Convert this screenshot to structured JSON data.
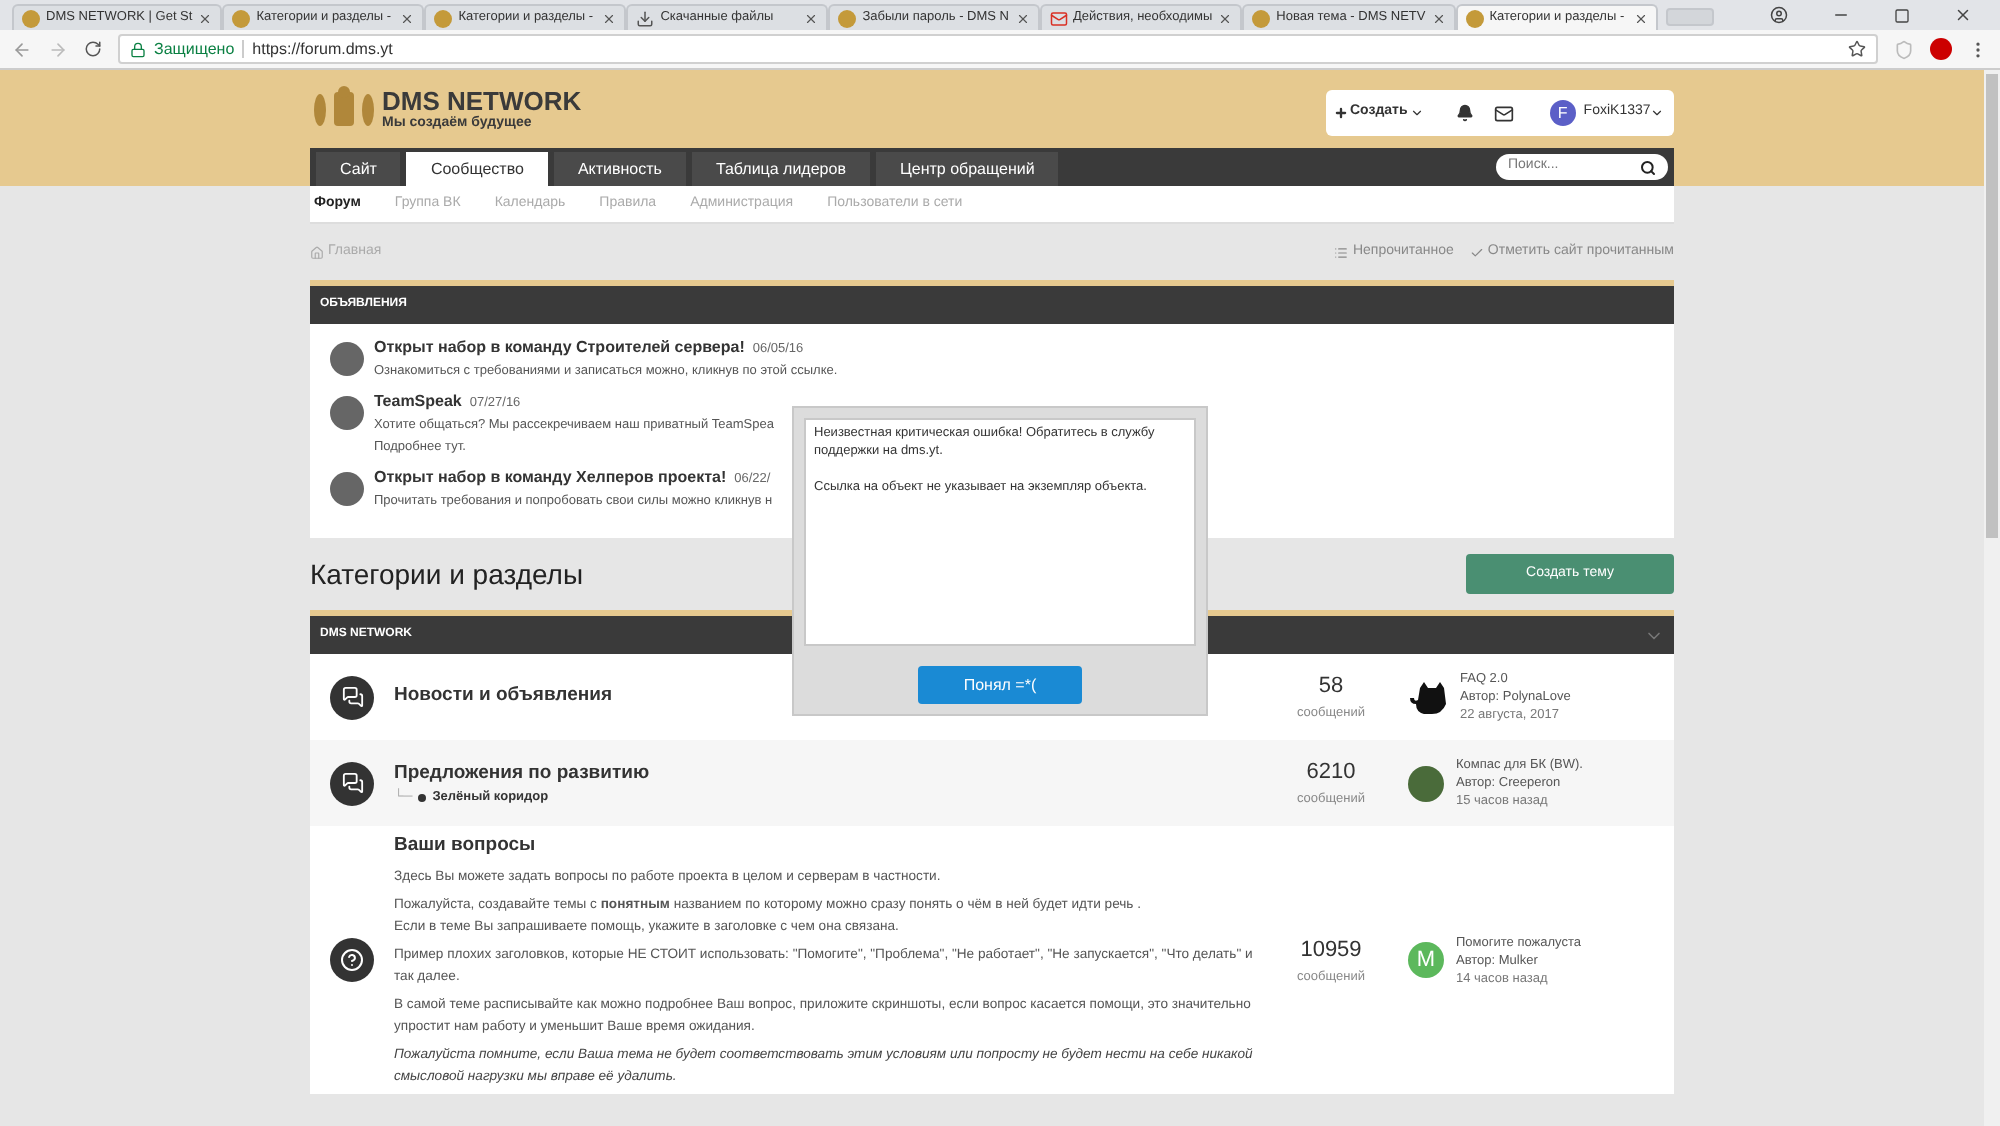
{
  "browser": {
    "tabs": [
      {
        "title": "DMS NETWORK | Get St",
        "kind": "site",
        "selected": false
      },
      {
        "title": "Категории и разделы -",
        "kind": "site",
        "selected": false
      },
      {
        "title": "Категории и разделы -",
        "kind": "site",
        "selected": false
      },
      {
        "title": "Скачанные файлы",
        "kind": "download",
        "selected": false
      },
      {
        "title": "Забыли пароль - DMS N",
        "kind": "site",
        "selected": false
      },
      {
        "title": "Действия, необходимы",
        "kind": "mail",
        "selected": false
      },
      {
        "title": "Новая тема - DMS NETV",
        "kind": "site",
        "selected": false
      },
      {
        "title": "Категории и разделы -",
        "kind": "site",
        "selected": true
      }
    ],
    "secure_label": "Защищено",
    "url": "https://forum.dms.yt"
  },
  "header": {
    "logo_title": "DMS NETWORK",
    "logo_subtitle": "Мы создаём будущее",
    "create_label": "Создать",
    "avatar_letter": "F",
    "username": "FoxiK1337"
  },
  "nav": {
    "tabs": [
      {
        "label": "Сайт",
        "selected": false
      },
      {
        "label": "Сообщество",
        "selected": true
      },
      {
        "label": "Активность",
        "selected": false
      },
      {
        "label": "Таблица лидеров",
        "selected": false
      },
      {
        "label": "Центр обращений",
        "selected": false
      }
    ],
    "search_placeholder": "Поиск..."
  },
  "subnav": [
    {
      "label": "Форум",
      "selected": true
    },
    {
      "label": "Группа ВК",
      "selected": false
    },
    {
      "label": "Календарь",
      "selected": false
    },
    {
      "label": "Правила",
      "selected": false
    },
    {
      "label": "Администрация",
      "selected": false
    },
    {
      "label": "Пользователи в сети",
      "selected": false
    }
  ],
  "breadcrumb": "Главная",
  "actions": [
    {
      "label": "Непрочитанное",
      "kind": "list"
    },
    {
      "label": "Отметить сайт прочитанным",
      "kind": "check"
    }
  ],
  "announcements": {
    "title": "ОБЪЯВЛЕНИЯ",
    "items": [
      {
        "title": "Открыт набор в команду Строителей сервера!",
        "date": "06/05/16",
        "lines": [
          "Ознакомиться с требованиями и записаться можно, кликнув по этой ссылке."
        ]
      },
      {
        "title": "TeamSpeak",
        "date": "07/27/16",
        "lines": [
          "Хотите общаться? Мы рассекречиваем наш приватный TeamSpea",
          "Подробнее тут."
        ]
      },
      {
        "title": "Открыт набор в команду Хелперов проекта!",
        "date": "06/22/",
        "lines": [
          "Прочитать требования и попробовать свои силы можно кликнув н"
        ]
      }
    ]
  },
  "categories_title": "Категории и разделы",
  "create_topic": "Создать тему",
  "section": {
    "title": "DMS NETWORK",
    "forums": [
      {
        "kind": "chat",
        "title": "Новости и объявления",
        "count": "58",
        "count_label": "сообщений",
        "last": {
          "kind": "cat",
          "title": "FAQ 2.0",
          "author": "Автор: PolynaLove",
          "time": "22 августа, 2017"
        }
      },
      {
        "kind": "chat",
        "title": "Предложения по развитию",
        "subforum_prefix": "└─",
        "subforum": "Зелёный коридор",
        "count": "6210",
        "count_label": "сообщений",
        "last": {
          "kind": "picture",
          "title": "Компас для БК (BW).",
          "author": "Автор: Creeperon",
          "time": "15 часов назад"
        }
      },
      {
        "kind": "question",
        "title": "Ваши вопросы",
        "paragraphs": [
          {
            "italic": false,
            "lines": [
              "Здесь Вы можете задать вопросы по работе проекта в целом и серверам в частности."
            ]
          },
          {
            "italic": false,
            "lines": [
              "Пожалуйста, создавайте темы с **понятным** названием по которому можно сразу понять о чём в ней будет идти речь .",
              "Если в теме Вы запрашиваете помощь, укажите в заголовке с чем она связана."
            ]
          },
          {
            "italic": false,
            "lines": [
              "Пример плохих заголовков, которые НЕ СТОИТ использовать: \"Помогите\",  \"Проблема\", \"Не работает\", \"Не запускается\", \"Что делать\" и так далее."
            ]
          },
          {
            "italic": false,
            "lines": [
              "В самой теме расписывайте как можно подробнее Ваш вопрос, приложите скриншоты, если вопрос касается помощи, это значительно упростит нам работу и уменьшит Ваше время ожидания."
            ]
          },
          {
            "italic": true,
            "lines": [
              "Пожалуйста помните, если Ваша тема не будет соответствовать этим условиям или попросту не будет нести на себе никакой смысловой нагрузки мы вправе её удалить."
            ]
          }
        ],
        "count": "10959",
        "count_label": "сообщений",
        "last": {
          "kind": "letter",
          "letter": "M",
          "title": "Помогите пожалуста",
          "author": "Автор: Mulker",
          "time": "14 часов назад"
        }
      }
    ]
  },
  "dialog": {
    "paragraphs": [
      "Неизвестная критическая ошибка! Обратитесь в службу поддержки на dms.yt.",
      "Ссылка на объект не указывает на экземпляр объекта."
    ],
    "button": "Понял =*("
  }
}
